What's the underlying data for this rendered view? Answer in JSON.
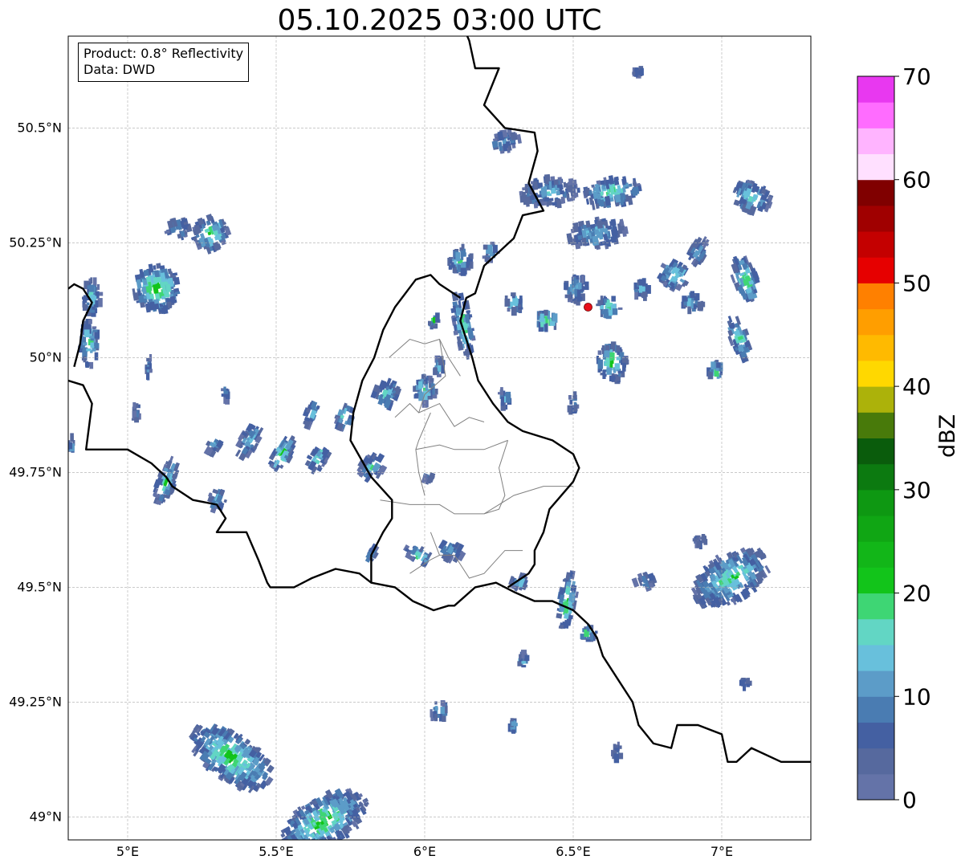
{
  "title": "05.10.2025 03:00 UTC",
  "info": {
    "product_label": "Product: 0.8° Reflectivity",
    "data_label": "Data: DWD"
  },
  "map": {
    "lon_range": [
      4.8,
      7.3
    ],
    "lat_range": [
      48.95,
      50.7
    ],
    "lon_ticks": [
      {
        "value": 5.0,
        "label": "5°E"
      },
      {
        "value": 5.5,
        "label": "5.5°E"
      },
      {
        "value": 6.0,
        "label": "6°E"
      },
      {
        "value": 6.5,
        "label": "6.5°E"
      },
      {
        "value": 7.0,
        "label": "7°E"
      }
    ],
    "lat_ticks": [
      {
        "value": 49.0,
        "label": "49°N"
      },
      {
        "value": 49.25,
        "label": "49.25°N"
      },
      {
        "value": 49.5,
        "label": "49.5°N"
      },
      {
        "value": 49.75,
        "label": "49.75°N"
      },
      {
        "value": 50.0,
        "label": "50°N"
      },
      {
        "value": 50.25,
        "label": "50.25°N"
      },
      {
        "value": 50.5,
        "label": "50.5°N"
      }
    ],
    "grid": true,
    "radar_site": {
      "lon": 6.55,
      "lat": 50.11,
      "color": "#e8101a"
    },
    "border_color": "#000000",
    "district_color": "#808080"
  },
  "colorbar": {
    "label": "dBZ",
    "min": 0,
    "max": 70,
    "ticks": [
      {
        "value": 0,
        "label": "0"
      },
      {
        "value": 10,
        "label": "10"
      },
      {
        "value": 20,
        "label": "20"
      },
      {
        "value": 30,
        "label": "30"
      },
      {
        "value": 40,
        "label": "40"
      },
      {
        "value": 50,
        "label": "50"
      },
      {
        "value": 60,
        "label": "60"
      },
      {
        "value": 70,
        "label": "70"
      }
    ],
    "colors": [
      "#6473a8",
      "#56699e",
      "#4460a2",
      "#4a7cb2",
      "#5c9cc8",
      "#68c0dc",
      "#62d6c4",
      "#3ed674",
      "#12c41a",
      "#12b618",
      "#10a614",
      "#0e9812",
      "#0c7a10",
      "#0a5c0c",
      "#487a0a",
      "#acb20a",
      "#ffd800",
      "#ffba00",
      "#ff9e00",
      "#ff8000",
      "#e60000",
      "#c40000",
      "#a00000",
      "#800000",
      "#ffe0ff",
      "#ffb4ff",
      "#ff6cff",
      "#e838f0"
    ]
  },
  "echoes": [
    {
      "lon": 5.1,
      "lat": 50.15,
      "rx": 0.08,
      "ry": 0.05,
      "ang": -10,
      "intensity": 24
    },
    {
      "lon": 4.88,
      "lat": 50.13,
      "rx": 0.03,
      "ry": 0.04,
      "ang": 0,
      "intensity": 16
    },
    {
      "lon": 4.87,
      "lat": 50.03,
      "rx": 0.03,
      "ry": 0.05,
      "ang": 0,
      "intensity": 20
    },
    {
      "lon": 5.28,
      "lat": 50.27,
      "rx": 0.06,
      "ry": 0.035,
      "ang": -20,
      "intensity": 22
    },
    {
      "lon": 5.17,
      "lat": 50.28,
      "rx": 0.04,
      "ry": 0.02,
      "ang": -15,
      "intensity": 15
    },
    {
      "lon": 5.07,
      "lat": 49.98,
      "rx": 0.01,
      "ry": 0.03,
      "ang": 0,
      "intensity": 12
    },
    {
      "lon": 5.03,
      "lat": 49.88,
      "rx": 0.01,
      "ry": 0.025,
      "ang": 0,
      "intensity": 10
    },
    {
      "lon": 5.33,
      "lat": 49.92,
      "rx": 0.01,
      "ry": 0.02,
      "ang": 0,
      "intensity": 10
    },
    {
      "lon": 4.81,
      "lat": 49.81,
      "rx": 0.01,
      "ry": 0.02,
      "ang": 0,
      "intensity": 14
    },
    {
      "lon": 5.13,
      "lat": 49.73,
      "rx": 0.03,
      "ry": 0.05,
      "ang": 20,
      "intensity": 18
    },
    {
      "lon": 5.3,
      "lat": 49.69,
      "rx": 0.03,
      "ry": 0.02,
      "ang": 20,
      "intensity": 14
    },
    {
      "lon": 5.29,
      "lat": 49.81,
      "rx": 0.025,
      "ry": 0.02,
      "ang": 30,
      "intensity": 14
    },
    {
      "lon": 5.41,
      "lat": 49.82,
      "rx": 0.03,
      "ry": 0.04,
      "ang": 30,
      "intensity": 14
    },
    {
      "lon": 5.52,
      "lat": 49.79,
      "rx": 0.03,
      "ry": 0.04,
      "ang": 30,
      "intensity": 22
    },
    {
      "lon": 5.64,
      "lat": 49.78,
      "rx": 0.03,
      "ry": 0.03,
      "ang": 30,
      "intensity": 20
    },
    {
      "lon": 5.62,
      "lat": 49.88,
      "rx": 0.02,
      "ry": 0.03,
      "ang": 20,
      "intensity": 16
    },
    {
      "lon": 5.73,
      "lat": 49.87,
      "rx": 0.025,
      "ry": 0.03,
      "ang": 20,
      "intensity": 20
    },
    {
      "lon": 5.82,
      "lat": 49.76,
      "rx": 0.04,
      "ry": 0.03,
      "ang": 30,
      "intensity": 16
    },
    {
      "lon": 5.87,
      "lat": 49.92,
      "rx": 0.04,
      "ry": 0.03,
      "ang": 20,
      "intensity": 16
    },
    {
      "lon": 6.0,
      "lat": 49.93,
      "rx": 0.04,
      "ry": 0.03,
      "ang": 0,
      "intensity": 18
    },
    {
      "lon": 5.98,
      "lat": 49.57,
      "rx": 0.05,
      "ry": 0.015,
      "ang": 30,
      "intensity": 20
    },
    {
      "lon": 5.82,
      "lat": 49.57,
      "rx": 0.015,
      "ry": 0.02,
      "ang": 30,
      "intensity": 14
    },
    {
      "lon": 6.09,
      "lat": 49.58,
      "rx": 0.04,
      "ry": 0.02,
      "ang": 30,
      "intensity": 14
    },
    {
      "lon": 6.01,
      "lat": 49.74,
      "rx": 0.02,
      "ry": 0.01,
      "ang": 20,
      "intensity": 12
    },
    {
      "lon": 6.13,
      "lat": 50.07,
      "rx": 0.03,
      "ry": 0.07,
      "ang": -10,
      "intensity": 22
    },
    {
      "lon": 6.12,
      "lat": 50.21,
      "rx": 0.04,
      "ry": 0.03,
      "ang": 0,
      "intensity": 18
    },
    {
      "lon": 6.03,
      "lat": 50.08,
      "rx": 0.015,
      "ry": 0.015,
      "ang": 0,
      "intensity": 22
    },
    {
      "lon": 6.05,
      "lat": 49.98,
      "rx": 0.02,
      "ry": 0.02,
      "ang": 0,
      "intensity": 16
    },
    {
      "lon": 6.22,
      "lat": 50.23,
      "rx": 0.03,
      "ry": 0.02,
      "ang": 0,
      "intensity": 16
    },
    {
      "lon": 6.27,
      "lat": 50.47,
      "rx": 0.05,
      "ry": 0.02,
      "ang": -10,
      "intensity": 12
    },
    {
      "lon": 6.42,
      "lat": 50.36,
      "rx": 0.1,
      "ry": 0.03,
      "ang": -5,
      "intensity": 14
    },
    {
      "lon": 6.63,
      "lat": 50.36,
      "rx": 0.1,
      "ry": 0.03,
      "ang": -10,
      "intensity": 20
    },
    {
      "lon": 6.58,
      "lat": 50.27,
      "rx": 0.1,
      "ry": 0.03,
      "ang": -10,
      "intensity": 14
    },
    {
      "lon": 6.41,
      "lat": 50.08,
      "rx": 0.04,
      "ry": 0.02,
      "ang": 0,
      "intensity": 22
    },
    {
      "lon": 6.3,
      "lat": 50.12,
      "rx": 0.03,
      "ry": 0.02,
      "ang": 0,
      "intensity": 20
    },
    {
      "lon": 6.62,
      "lat": 50.11,
      "rx": 0.04,
      "ry": 0.02,
      "ang": 0,
      "intensity": 20
    },
    {
      "lon": 6.51,
      "lat": 50.15,
      "rx": 0.04,
      "ry": 0.03,
      "ang": 0,
      "intensity": 14
    },
    {
      "lon": 6.63,
      "lat": 49.99,
      "rx": 0.05,
      "ry": 0.04,
      "ang": 0,
      "intensity": 22
    },
    {
      "lon": 6.73,
      "lat": 50.15,
      "rx": 0.03,
      "ry": 0.02,
      "ang": 0,
      "intensity": 14
    },
    {
      "lon": 6.84,
      "lat": 50.18,
      "rx": 0.05,
      "ry": 0.03,
      "ang": 30,
      "intensity": 20
    },
    {
      "lon": 6.92,
      "lat": 50.23,
      "rx": 0.03,
      "ry": 0.03,
      "ang": 30,
      "intensity": 14
    },
    {
      "lon": 6.9,
      "lat": 50.12,
      "rx": 0.04,
      "ry": 0.02,
      "ang": 0,
      "intensity": 14
    },
    {
      "lon": 7.08,
      "lat": 50.17,
      "rx": 0.04,
      "ry": 0.05,
      "ang": -20,
      "intensity": 22
    },
    {
      "lon": 7.06,
      "lat": 50.04,
      "rx": 0.03,
      "ry": 0.05,
      "ang": -20,
      "intensity": 20
    },
    {
      "lon": 7.1,
      "lat": 50.35,
      "rx": 0.07,
      "ry": 0.03,
      "ang": 20,
      "intensity": 18
    },
    {
      "lon": 6.98,
      "lat": 49.97,
      "rx": 0.025,
      "ry": 0.02,
      "ang": 0,
      "intensity": 20
    },
    {
      "lon": 6.5,
      "lat": 49.9,
      "rx": 0.015,
      "ry": 0.025,
      "ang": 0,
      "intensity": 14
    },
    {
      "lon": 6.27,
      "lat": 49.91,
      "rx": 0.02,
      "ry": 0.02,
      "ang": 0,
      "intensity": 14
    },
    {
      "lon": 7.03,
      "lat": 49.52,
      "rx": 0.14,
      "ry": 0.05,
      "ang": -30,
      "intensity": 20
    },
    {
      "lon": 6.48,
      "lat": 49.47,
      "rx": 0.03,
      "ry": 0.06,
      "ang": 10,
      "intensity": 22
    },
    {
      "lon": 6.55,
      "lat": 49.4,
      "rx": 0.03,
      "ry": 0.015,
      "ang": 0,
      "intensity": 18
    },
    {
      "lon": 6.74,
      "lat": 49.51,
      "rx": 0.04,
      "ry": 0.015,
      "ang": -20,
      "intensity": 12
    },
    {
      "lon": 6.32,
      "lat": 49.51,
      "rx": 0.03,
      "ry": 0.015,
      "ang": 20,
      "intensity": 14
    },
    {
      "lon": 6.33,
      "lat": 49.34,
      "rx": 0.02,
      "ry": 0.015,
      "ang": 0,
      "intensity": 16
    },
    {
      "lon": 6.05,
      "lat": 49.23,
      "rx": 0.03,
      "ry": 0.02,
      "ang": 0,
      "intensity": 16
    },
    {
      "lon": 6.3,
      "lat": 49.2,
      "rx": 0.015,
      "ry": 0.01,
      "ang": 0,
      "intensity": 14
    },
    {
      "lon": 6.65,
      "lat": 49.14,
      "rx": 0.015,
      "ry": 0.015,
      "ang": 0,
      "intensity": 12
    },
    {
      "lon": 7.08,
      "lat": 49.29,
      "rx": 0.015,
      "ry": 0.008,
      "ang": 0,
      "intensity": 12
    },
    {
      "lon": 5.35,
      "lat": 49.13,
      "rx": 0.16,
      "ry": 0.05,
      "ang": 35,
      "intensity": 22
    },
    {
      "lon": 5.66,
      "lat": 48.99,
      "rx": 0.16,
      "ry": 0.05,
      "ang": -30,
      "intensity": 22
    },
    {
      "lon": 6.93,
      "lat": 49.6,
      "rx": 0.025,
      "ry": 0.008,
      "ang": 0,
      "intensity": 12
    },
    {
      "lon": 6.72,
      "lat": 50.62,
      "rx": 0.015,
      "ry": 0.006,
      "ang": 0,
      "intensity": 10
    }
  ]
}
